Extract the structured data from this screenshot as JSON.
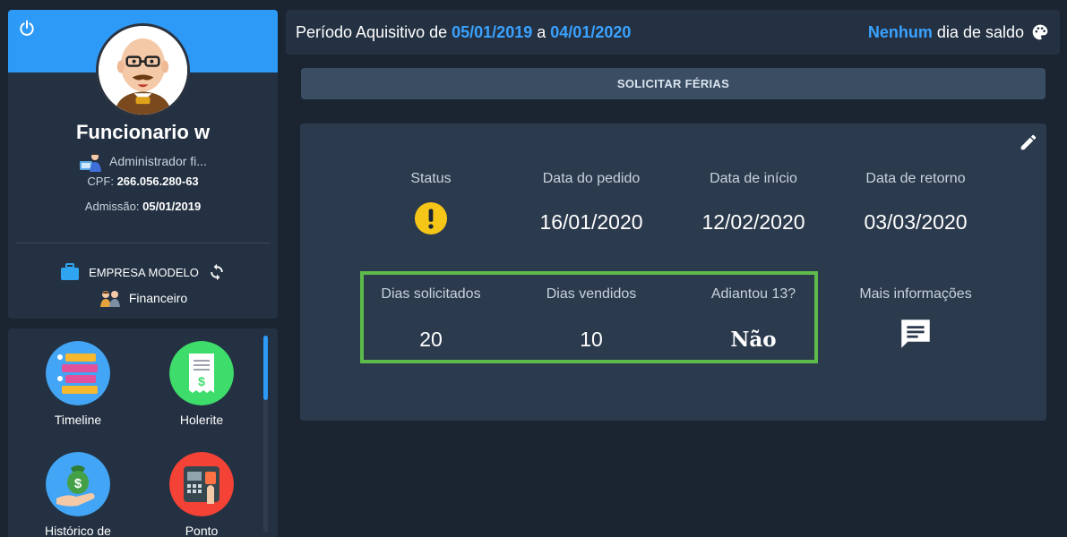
{
  "profile": {
    "name": "Funcionario w",
    "role": "Administrador fi...",
    "cpf_label": "CPF:",
    "cpf": "266.056.280-63",
    "admission_label": "Admissão:",
    "admission": "05/01/2019",
    "company": "EMPRESA MODELO",
    "department": "Financeiro"
  },
  "apps": [
    {
      "label": "Timeline",
      "icon": "timeline-icon",
      "color": "#42a5f5"
    },
    {
      "label": "Holerite",
      "icon": "payslip-icon",
      "color": "#3ddc6b"
    },
    {
      "label": "Histórico de",
      "icon": "salary-history-icon",
      "color": "#42a5f5"
    },
    {
      "label": "Ponto",
      "icon": "time-clock-icon",
      "color": "#f44336"
    }
  ],
  "header": {
    "period_prefix": "Período Aquisitivo de",
    "start_date": "05/01/2019",
    "connector": "a",
    "end_date": "04/01/2020",
    "balance_highlight": "Nenhum",
    "balance_suffix": "dia de saldo"
  },
  "request_button": "SOLICITAR FÉRIAS",
  "vacation": {
    "status_label": "Status",
    "status_icon": "warning-icon",
    "order_date_label": "Data do pedido",
    "order_date": "16/01/2020",
    "start_label": "Data de início",
    "start": "12/02/2020",
    "return_label": "Data de retorno",
    "return": "03/03/2020",
    "requested_label": "Dias solicitados",
    "requested": "20",
    "sold_label": "Dias vendidos",
    "sold": "10",
    "advance_label": "Adiantou 13?",
    "advance": "Não",
    "more_info_label": "Mais informações"
  },
  "colors": {
    "accent": "#2e9af7",
    "highlight": "#5dbb4b",
    "warning": "#f5c518"
  }
}
